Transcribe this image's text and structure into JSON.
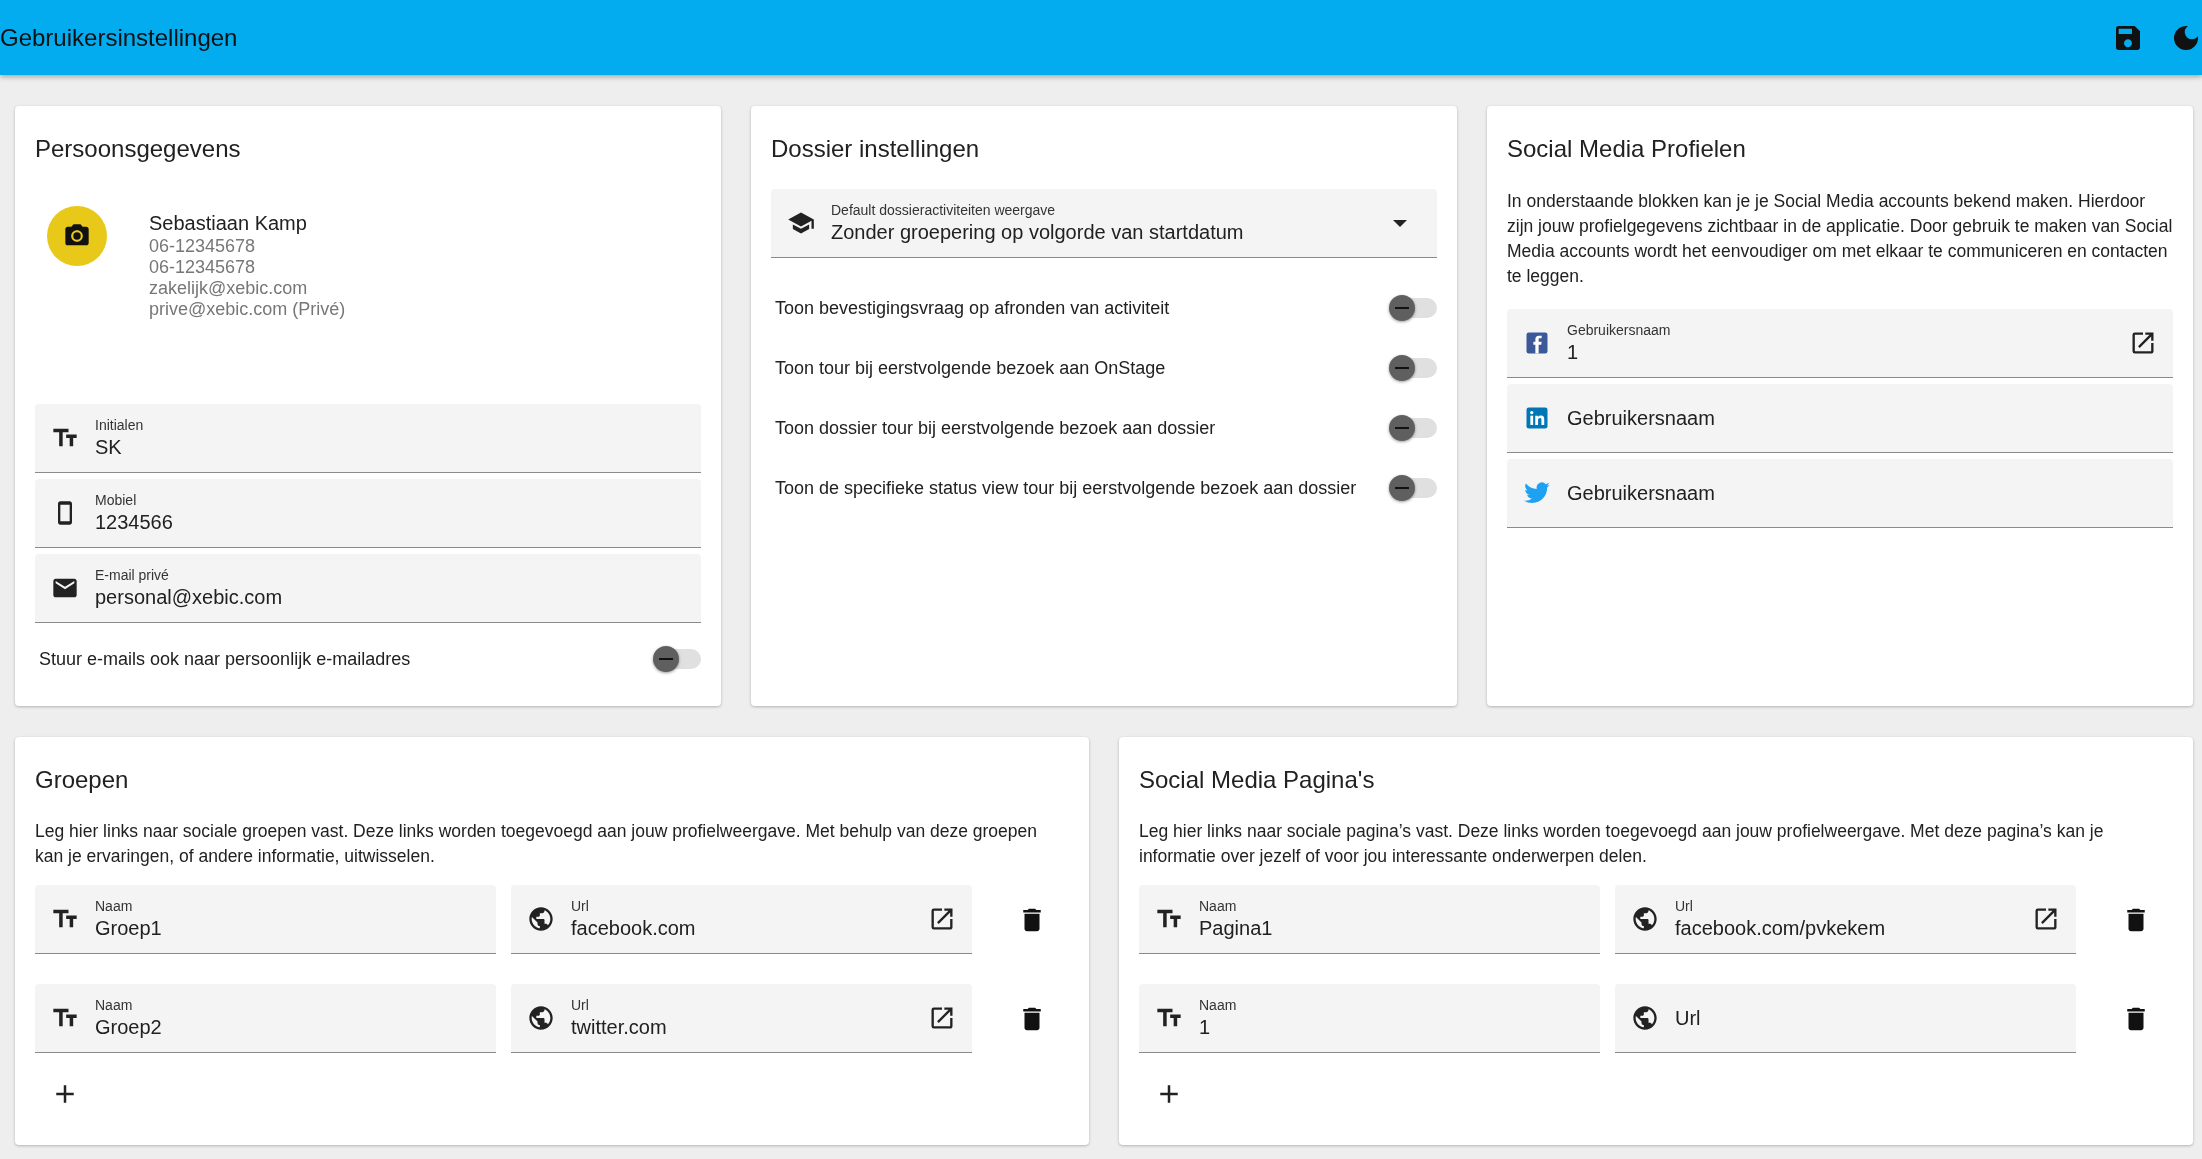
{
  "app_bar": {
    "title": "Gebruikersinstellingen"
  },
  "personal": {
    "title": "Persoonsgegevens",
    "name": "Sebastiaan Kamp",
    "details": [
      "06-12345678",
      "06-12345678",
      "zakelijk@xebic.com",
      "prive@xebic.com (Privé)"
    ],
    "fields": [
      {
        "kind": "text",
        "label": "Initialen",
        "value": "SK"
      },
      {
        "kind": "phone",
        "label": "Mobiel",
        "value": "1234566"
      },
      {
        "kind": "mail",
        "label": "E-mail privé",
        "value": "personal@xebic.com"
      }
    ],
    "toggle": {
      "label": "Stuur e-mails ook naar persoonlijk e-mailadres",
      "on": false
    }
  },
  "dossier": {
    "title": "Dossier instellingen",
    "select": {
      "label": "Default dossieractiviteiten weergave",
      "value": "Zonder groepering op volgorde van startdatum"
    },
    "toggles": [
      {
        "label": "Toon bevestigingsvraag op afronden van activiteit",
        "on": false
      },
      {
        "label": "Toon tour bij eerstvolgende bezoek aan OnStage",
        "on": false
      },
      {
        "label": "Toon dossier tour bij eerstvolgende bezoek aan dossier",
        "on": false
      },
      {
        "label": "Toon de specifieke status view tour bij eerstvolgende bezoek aan dossier",
        "on": false
      }
    ]
  },
  "social_profiles": {
    "title": "Social Media Profielen",
    "description": "In onderstaande blokken kan je je Social Media accounts bekend maken. Hierdoor zijn jouw profielgegevens zichtbaar in de applicatie. Door gebruik te maken van Social Media accounts wordt het eenvoudiger om met elkaar te communiceren en contacten te leggen.",
    "fields": [
      {
        "kind": "facebook",
        "label": "Gebruikersnaam",
        "value": "1"
      },
      {
        "kind": "linkedin",
        "label": "Gebruikersnaam"
      },
      {
        "kind": "twitter",
        "label": "Gebruikersnaam"
      }
    ]
  },
  "groups": {
    "title": "Groepen",
    "description": "Leg hier links naar sociale groepen vast. Deze links worden toegevoegd aan jouw profielweergave. Met behulp van deze groepen kan je ervaringen, of andere informatie, uitwisselen.",
    "rows": [
      {
        "name": {
          "label": "Naam",
          "value": "Groep1"
        },
        "url": {
          "label": "Url",
          "value": "facebook.com"
        }
      },
      {
        "name": {
          "label": "Naam",
          "value": "Groep2"
        },
        "url": {
          "label": "Url",
          "value": "twitter.com"
        }
      }
    ]
  },
  "pages": {
    "title": "Social Media Pagina's",
    "description": "Leg hier links naar sociale pagina’s vast. Deze links worden toegevoegd aan jouw profielweergave. Met deze pagina’s kan je informatie over jezelf of voor jou interessante onderwerpen delen.",
    "rows": [
      {
        "name": {
          "label": "Naam",
          "value": "Pagina1"
        },
        "url": {
          "label": "Url",
          "value": "facebook.com/pvkekem"
        }
      },
      {
        "name": {
          "label": "Naam",
          "value": "1"
        },
        "url": {
          "label": "Url"
        }
      }
    ]
  }
}
